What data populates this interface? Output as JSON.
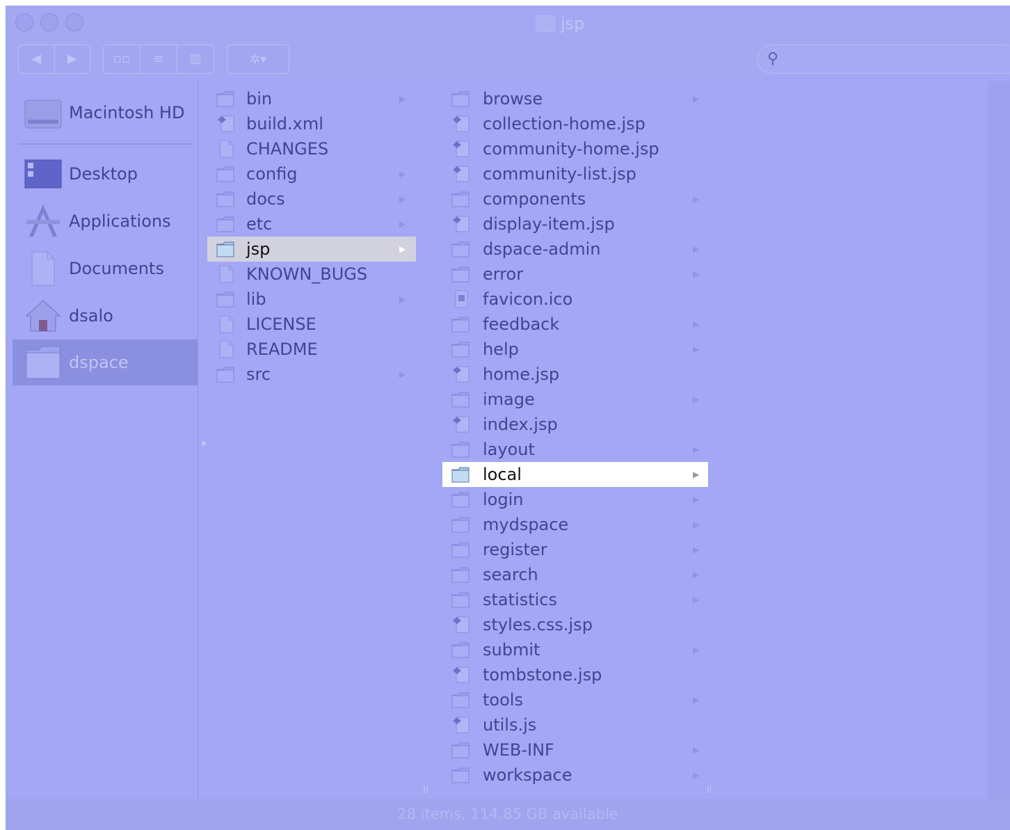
{
  "window": {
    "title": "jsp",
    "status": "28 items, 114.85 GB available"
  },
  "toolbar": {
    "back_label": "◀",
    "forward_label": "▶",
    "view_icon_label": "▫▫",
    "view_list_label": "≡",
    "view_column_label": "▥",
    "action_label": "✲▾",
    "search_placeholder": "",
    "search_icon": "⚲"
  },
  "sidebar": {
    "items": [
      {
        "label": "Macintosh HD",
        "icon": "hard-drive-icon"
      },
      {
        "label": "Desktop",
        "icon": "desktop-icon"
      },
      {
        "label": "Applications",
        "icon": "applications-icon"
      },
      {
        "label": "Documents",
        "icon": "document-icon"
      },
      {
        "label": "dsalo",
        "icon": "home-icon"
      },
      {
        "label": "dspace",
        "icon": "folder-icon",
        "selected": true
      }
    ]
  },
  "column1": {
    "items": [
      {
        "label": "bin",
        "type": "folder"
      },
      {
        "label": "build.xml",
        "type": "script"
      },
      {
        "label": "CHANGES",
        "type": "file"
      },
      {
        "label": "config",
        "type": "folder"
      },
      {
        "label": "docs",
        "type": "folder"
      },
      {
        "label": "etc",
        "type": "folder"
      },
      {
        "label": "jsp",
        "type": "folder",
        "selected": true
      },
      {
        "label": "KNOWN_BUGS",
        "type": "file"
      },
      {
        "label": "lib",
        "type": "folder"
      },
      {
        "label": "LICENSE",
        "type": "file"
      },
      {
        "label": "README",
        "type": "file"
      },
      {
        "label": "src",
        "type": "folder"
      }
    ]
  },
  "column2": {
    "items": [
      {
        "label": "browse",
        "type": "folder"
      },
      {
        "label": "collection-home.jsp",
        "type": "script"
      },
      {
        "label": "community-home.jsp",
        "type": "script"
      },
      {
        "label": "community-list.jsp",
        "type": "script"
      },
      {
        "label": "components",
        "type": "folder"
      },
      {
        "label": "display-item.jsp",
        "type": "script"
      },
      {
        "label": "dspace-admin",
        "type": "folder"
      },
      {
        "label": "error",
        "type": "folder"
      },
      {
        "label": "favicon.ico",
        "type": "image"
      },
      {
        "label": "feedback",
        "type": "folder"
      },
      {
        "label": "help",
        "type": "folder"
      },
      {
        "label": "home.jsp",
        "type": "script"
      },
      {
        "label": "image",
        "type": "folder"
      },
      {
        "label": "index.jsp",
        "type": "script"
      },
      {
        "label": "layout",
        "type": "folder"
      },
      {
        "label": "local",
        "type": "folder",
        "selected": true
      },
      {
        "label": "login",
        "type": "folder"
      },
      {
        "label": "mydspace",
        "type": "folder"
      },
      {
        "label": "register",
        "type": "folder"
      },
      {
        "label": "search",
        "type": "folder"
      },
      {
        "label": "statistics",
        "type": "folder"
      },
      {
        "label": "styles.css.jsp",
        "type": "script"
      },
      {
        "label": "submit",
        "type": "folder"
      },
      {
        "label": "tombstone.jsp",
        "type": "script"
      },
      {
        "label": "tools",
        "type": "folder"
      },
      {
        "label": "utils.js",
        "type": "script"
      },
      {
        "label": "WEB-INF",
        "type": "folder"
      },
      {
        "label": "workspace",
        "type": "folder"
      }
    ]
  },
  "column3": {
    "items": []
  },
  "colors": {
    "background": "#a3a7f6",
    "text": "#3f4494",
    "selection_white": "#ffffff",
    "selection_gray": "#d2d2de",
    "sidebar_selected": "#8b8fe0"
  }
}
